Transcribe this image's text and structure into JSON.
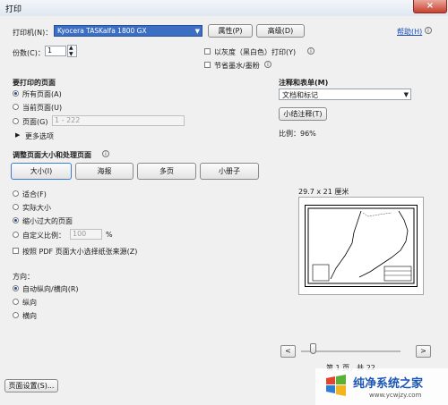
{
  "window": {
    "title": "打印",
    "close_label": "×"
  },
  "printer": {
    "label": "打印机(N)：",
    "selected": "Kyocera TASKalfa 1800 GX",
    "properties_button": "属性(P)",
    "advanced_button": "高级(D)",
    "help_link": "帮助(H)",
    "copies_label": "份数(C)：",
    "copies_value": "1",
    "grayscale_label": "以灰度（黑白色）打印(Y)",
    "save_ink_label": "节省墨水/墨粉"
  },
  "pages_section": {
    "title": "要打印的页面",
    "all": "所有页面(A)",
    "current": "当前页面(U)",
    "pages_label": "页面(G)",
    "pages_value": "1 - 222",
    "more_options": "更多选项"
  },
  "sizing_section": {
    "title": "调整页面大小和处理页面",
    "buttons": [
      "大小(I)",
      "海报",
      "多页",
      "小册子"
    ],
    "fit": "适合(F)",
    "actual": "实际大小",
    "shrink": "缩小过大的页面",
    "custom_label": "自定义比例：",
    "custom_value": "100",
    "custom_unit": "%",
    "paper_source": "按照 PDF 页面大小选择纸张来源(Z)"
  },
  "orientation_section": {
    "title": "方向：",
    "auto": "自动纵向/横向(R)",
    "portrait": "纵向",
    "landscape": "横向"
  },
  "comments_section": {
    "title": "注释和表单(M)",
    "selected": "文档和标记",
    "summarize_button": "小结注释(T)",
    "scale_text": "比例：96%"
  },
  "preview": {
    "paper_size": "29.7 x 21 厘米",
    "page_status": "第 1 页，共 22",
    "prev": "<",
    "next": ">"
  },
  "footer": {
    "page_setup_button": "页面设置(S)...",
    "watermark_brand": "纯净系统之家",
    "watermark_url": "www.ycwjzy.com"
  },
  "colors": {
    "accent": "#3a6fc4",
    "dialog_bg": "#f0f0f0"
  }
}
